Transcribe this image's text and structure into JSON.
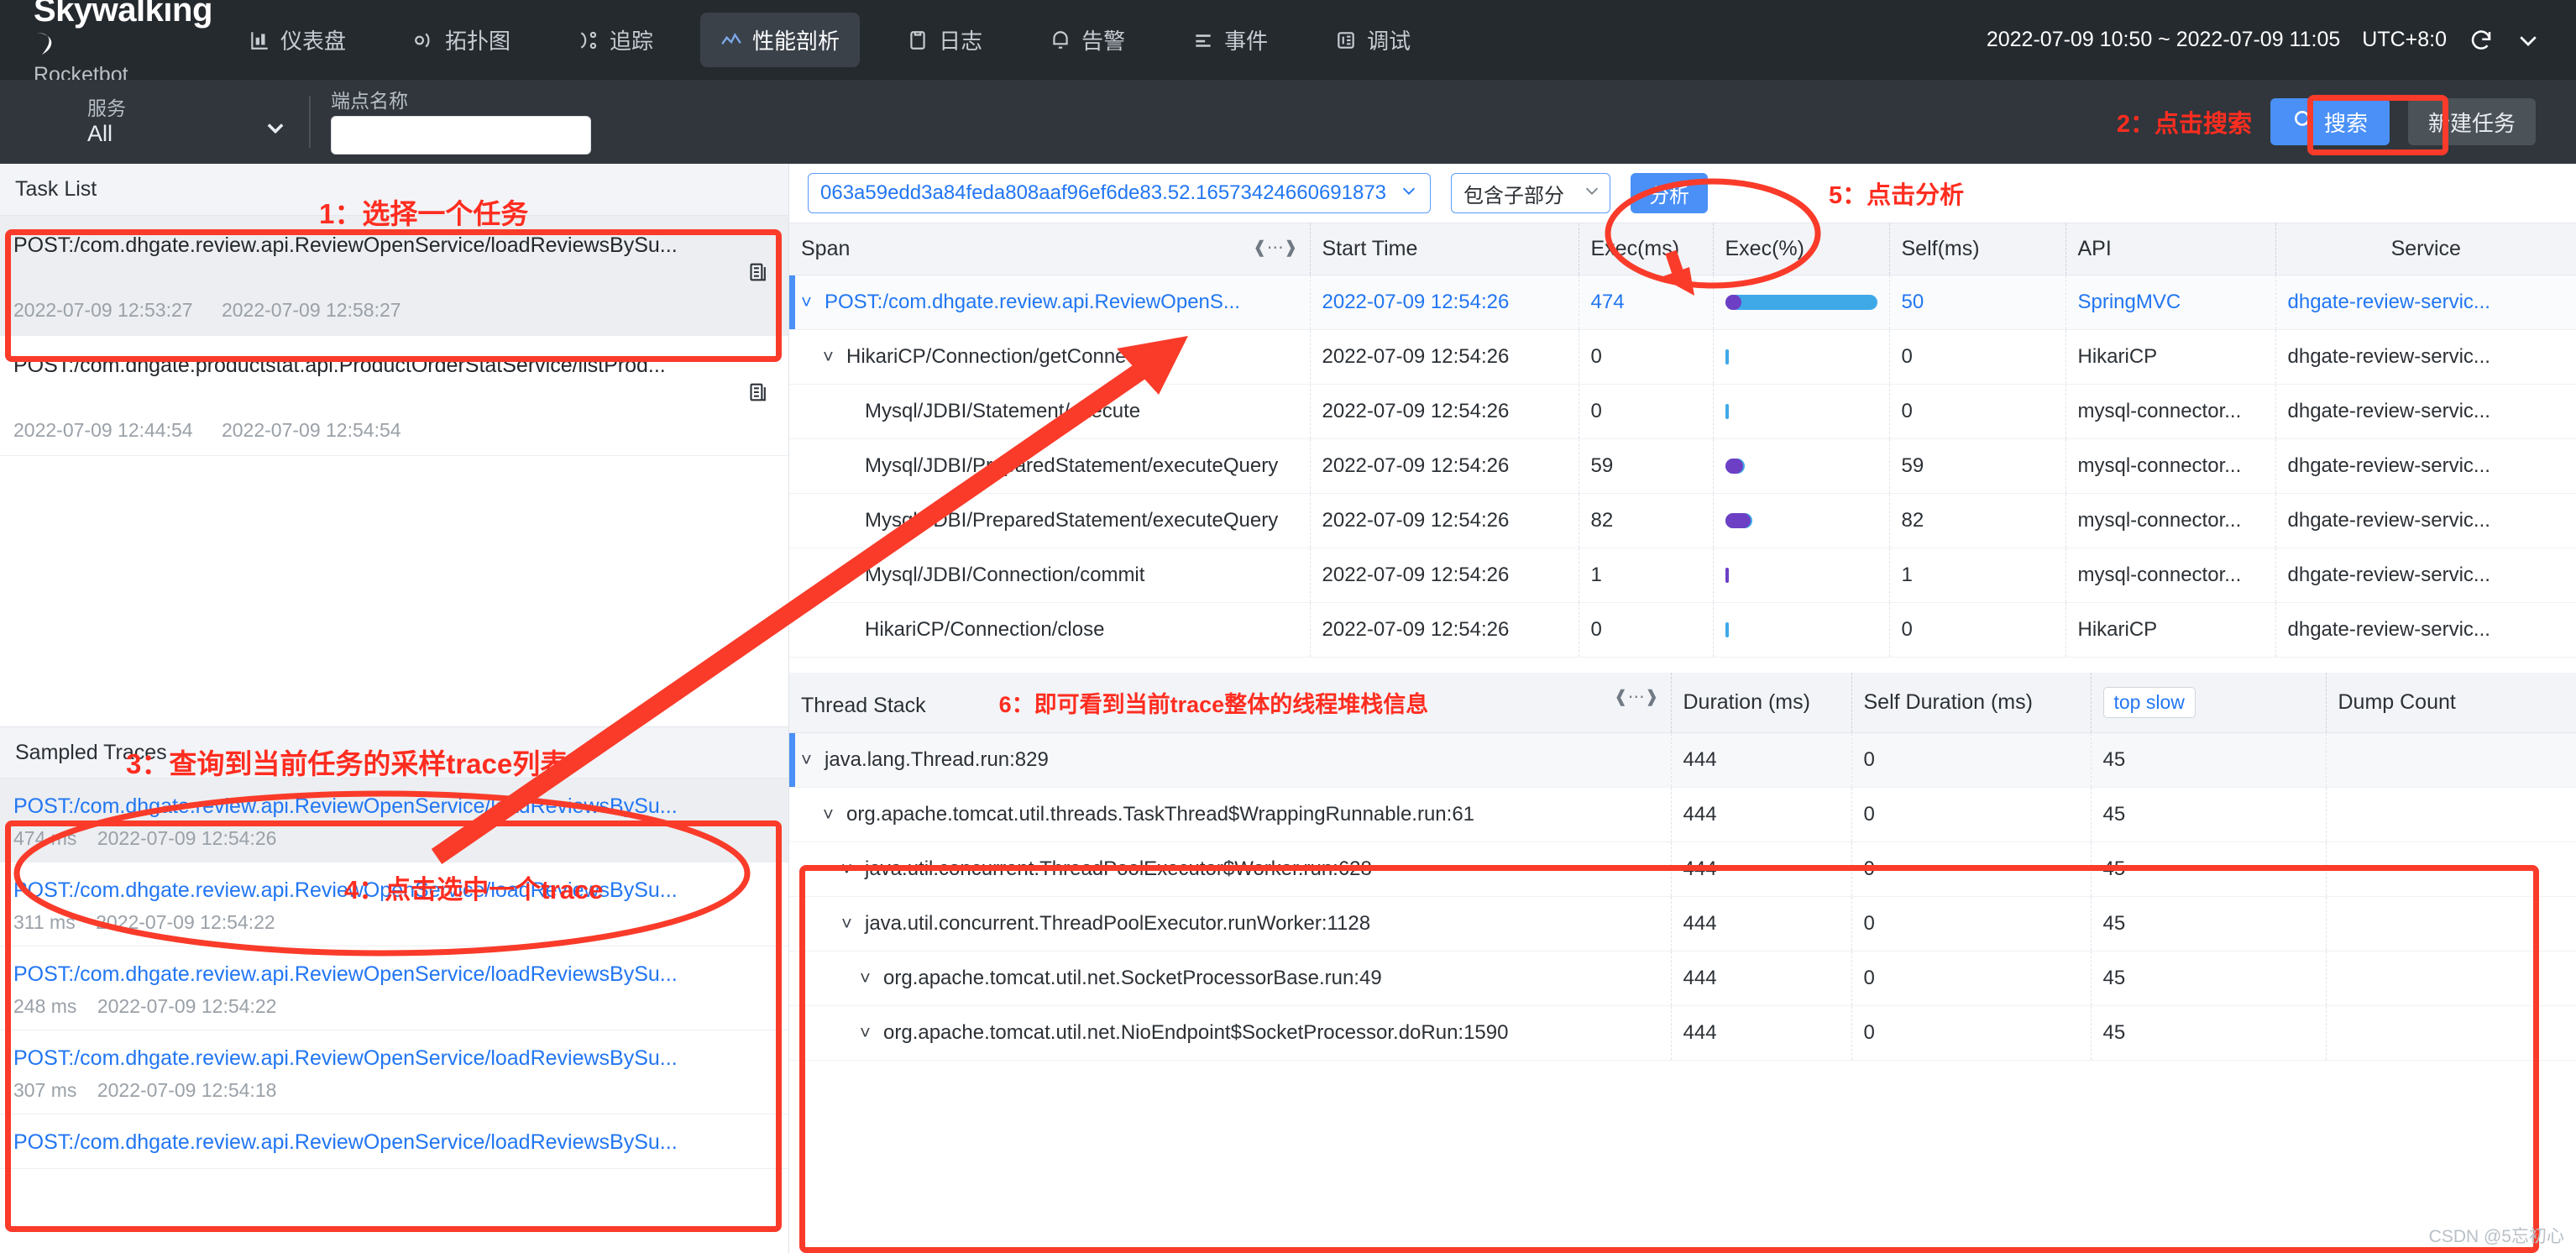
{
  "header": {
    "brand_name": "Skywalking",
    "brand_sub": "Rocketbot",
    "tabs": [
      {
        "label": "仪表盘",
        "icon": "dashboard-icon",
        "active": false
      },
      {
        "label": "拓扑图",
        "icon": "topology-icon",
        "active": false
      },
      {
        "label": "追踪",
        "icon": "trace-icon",
        "active": false
      },
      {
        "label": "性能剖析",
        "icon": "profile-icon",
        "active": true
      },
      {
        "label": "日志",
        "icon": "log-icon",
        "active": false
      },
      {
        "label": "告警",
        "icon": "alarm-icon",
        "active": false
      },
      {
        "label": "事件",
        "icon": "event-icon",
        "active": false
      },
      {
        "label": "调试",
        "icon": "debug-icon",
        "active": false
      }
    ],
    "time_range": "2022-07-09 10:50 ~ 2022-07-09 11:05",
    "timezone": "UTC+8:0",
    "reload_icon": "reload-icon",
    "chevron_icon": "chevron-down-icon"
  },
  "filterbar": {
    "service_label": "服务",
    "service_value": "All",
    "endpoint_label": "端点名称",
    "endpoint_value": "",
    "endpoint_placeholder": "",
    "search_label": "搜索",
    "search_icon": "search-icon",
    "new_task_label": "新建任务"
  },
  "left": {
    "task_list_title": "Task List",
    "tasks": [
      {
        "name": "POST:/com.dhgate.review.api.ReviewOpenService/loadReviewsBySu...",
        "start": "2022-07-09 12:53:27",
        "end": "2022-07-09 12:58:27",
        "selected": true
      },
      {
        "name": "POST:/com.dhgate.productstat.api.ProductOrderStatService/listProd...",
        "start": "2022-07-09 12:44:54",
        "end": "2022-07-09 12:54:54",
        "selected": false
      }
    ],
    "sampled_traces_title": "Sampled Traces",
    "traces": [
      {
        "name": "POST:/com.dhgate.review.api.ReviewOpenService/loadReviewsBySu...",
        "duration": "474 ms",
        "time": "2022-07-09 12:54:26",
        "selected": true
      },
      {
        "name": "POST:/com.dhgate.review.api.ReviewOpenService/loadReviewsBySu...",
        "duration": "311 ms",
        "time": "2022-07-09 12:54:22",
        "selected": false
      },
      {
        "name": "POST:/com.dhgate.review.api.ReviewOpenService/loadReviewsBySu...",
        "duration": "248 ms",
        "time": "2022-07-09 12:54:22",
        "selected": false
      },
      {
        "name": "POST:/com.dhgate.review.api.ReviewOpenService/loadReviewsBySu...",
        "duration": "307 ms",
        "time": "2022-07-09 12:54:18",
        "selected": false
      },
      {
        "name": "POST:/com.dhgate.review.api.ReviewOpenService/loadReviewsBySu...",
        "duration": "",
        "time": "",
        "selected": false
      }
    ]
  },
  "trace_toolbar": {
    "trace_id": "063a59edd3a84feda808aaf96ef6de83.52.16573424660691873",
    "scope_value": "包含子部分",
    "analyze_label": "分析",
    "chevron_icon": "chevron-down-icon"
  },
  "span_table": {
    "columns": [
      "Span",
      "Start Time",
      "Exec(ms)",
      "Exec(%)",
      "Self(ms)",
      "API",
      "Service"
    ],
    "resize_icon": "resize-handle-icon",
    "rows": [
      {
        "span": "POST:/com.dhgate.review.api.ReviewOpenS...",
        "indent": 0,
        "caret": true,
        "root": true,
        "selected": true,
        "start": "2022-07-09 12:54:26",
        "exec_ms": "474",
        "exec_pct_blue": 100,
        "exec_pct_purple": 11,
        "self_ms": "50",
        "api": "SpringMVC",
        "service": "dhgate-review-servic..."
      },
      {
        "span": "HikariCP/Connection/getConnection",
        "indent": 1,
        "caret": true,
        "root": false,
        "selected": false,
        "start": "2022-07-09 12:54:26",
        "exec_ms": "0",
        "exec_pct_blue": 1,
        "exec_pct_purple": 0,
        "self_ms": "0",
        "api": "HikariCP",
        "service": "dhgate-review-servic..."
      },
      {
        "span": "Mysql/JDBI/Statement/execute",
        "indent": 2,
        "caret": false,
        "root": false,
        "selected": false,
        "start": "2022-07-09 12:54:26",
        "exec_ms": "0",
        "exec_pct_blue": 1,
        "exec_pct_purple": 0,
        "self_ms": "0",
        "api": "mysql-connector...",
        "service": "dhgate-review-servic..."
      },
      {
        "span": "Mysql/JDBI/PreparedStatement/executeQuery",
        "indent": 2,
        "caret": false,
        "root": false,
        "selected": false,
        "start": "2022-07-09 12:54:26",
        "exec_ms": "59",
        "exec_pct_blue": 13,
        "exec_pct_purple": 12,
        "self_ms": "59",
        "api": "mysql-connector...",
        "service": "dhgate-review-servic..."
      },
      {
        "span": "Mysql/JDBI/PreparedStatement/executeQuery",
        "indent": 2,
        "caret": false,
        "root": false,
        "selected": false,
        "start": "2022-07-09 12:54:26",
        "exec_ms": "82",
        "exec_pct_blue": 18,
        "exec_pct_purple": 17,
        "self_ms": "82",
        "api": "mysql-connector...",
        "service": "dhgate-review-servic..."
      },
      {
        "span": "Mysql/JDBI/Connection/commit",
        "indent": 2,
        "caret": false,
        "root": false,
        "selected": false,
        "start": "2022-07-09 12:54:26",
        "exec_ms": "1",
        "exec_pct_blue": 1,
        "exec_pct_purple": 1,
        "self_ms": "1",
        "api": "mysql-connector...",
        "service": "dhgate-review-servic..."
      },
      {
        "span": "HikariCP/Connection/close",
        "indent": 2,
        "caret": false,
        "root": false,
        "selected": false,
        "start": "2022-07-09 12:54:26",
        "exec_ms": "0",
        "exec_pct_blue": 1,
        "exec_pct_purple": 0,
        "self_ms": "0",
        "api": "HikariCP",
        "service": "dhgate-review-servic..."
      }
    ]
  },
  "stack_table": {
    "title": "Thread Stack",
    "columns": [
      "Duration (ms)",
      "Self Duration (ms)",
      "Dump Count"
    ],
    "top_slow_label": "top slow",
    "resize_icon": "resize-handle-icon",
    "rows": [
      {
        "name": "java.lang.Thread.run:829",
        "indent": 0,
        "caret": true,
        "selected": true,
        "duration": "444",
        "self_duration": "0",
        "dump_count": "45"
      },
      {
        "name": "org.apache.tomcat.util.threads.TaskThread$WrappingRunnable.run:61",
        "indent": 1,
        "caret": true,
        "selected": false,
        "duration": "444",
        "self_duration": "0",
        "dump_count": "45"
      },
      {
        "name": "java.util.concurrent.ThreadPoolExecutor$Worker.run:628",
        "indent": 2,
        "caret": true,
        "selected": false,
        "duration": "444",
        "self_duration": "0",
        "dump_count": "45"
      },
      {
        "name": "java.util.concurrent.ThreadPoolExecutor.runWorker:1128",
        "indent": 2,
        "caret": true,
        "selected": false,
        "duration": "444",
        "self_duration": "0",
        "dump_count": "45"
      },
      {
        "name": "org.apache.tomcat.util.net.SocketProcessorBase.run:49",
        "indent": 3,
        "caret": true,
        "selected": false,
        "duration": "444",
        "self_duration": "0",
        "dump_count": "45"
      },
      {
        "name": "org.apache.tomcat.util.net.NioEndpoint$SocketProcessor.doRun:1590",
        "indent": 3,
        "caret": true,
        "selected": false,
        "duration": "444",
        "self_duration": "0",
        "dump_count": "45"
      }
    ]
  },
  "annotations": {
    "a1": "1：选择一个任务",
    "a2": "2：点击搜索",
    "a3": "3：查询到当前任务的采样trace列表",
    "a4": "4：点击选中一个trace",
    "a5": "5：点击分析",
    "a6": "6：即可看到当前trace整体的线程堆栈信息"
  },
  "watermark": "CSDN @5忘初心",
  "colors": {
    "nav_bg": "#252a2f",
    "filter_bg": "#30363c",
    "accent_blue": "#4a90f7",
    "link_blue": "#2176f3",
    "anno_red": "#ff2d20",
    "bar_blue": "#3fa9e8",
    "bar_purple": "#6d3fc4"
  }
}
